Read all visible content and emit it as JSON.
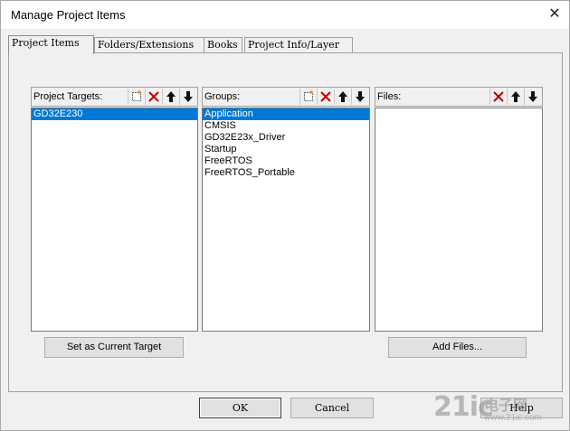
{
  "window": {
    "title": "Manage Project Items",
    "close_glyph": "✕"
  },
  "tabs": [
    {
      "label": "Project Items",
      "active": true
    },
    {
      "label": "Folders/Extensions",
      "active": false
    },
    {
      "label": "Books",
      "active": false
    },
    {
      "label": "Project Info/Layer",
      "active": false
    }
  ],
  "targets": {
    "label": "Project Targets:",
    "items": [
      "GD32E230"
    ],
    "selected": 0,
    "set_current_button": "Set as Current Target"
  },
  "groups": {
    "label": "Groups:",
    "items": [
      "Application",
      "CMSIS",
      "GD32E23x_Driver",
      "Startup",
      "FreeRTOS",
      "FreeRTOS_Portable"
    ],
    "selected": 0
  },
  "files": {
    "label": "Files:",
    "items": [],
    "add_files_button": "Add Files..."
  },
  "footer": {
    "ok": "OK",
    "cancel": "Cancel",
    "help": "Help"
  },
  "watermark": {
    "main": "21ic",
    "cn": "电子网",
    "url": "www.21ic.com"
  },
  "icons": {
    "new": "new-item-icon",
    "delete": "delete-icon",
    "up": "move-up-icon",
    "down": "move-down-icon"
  },
  "colors": {
    "selection": "#0078d7",
    "delete_red": "#c00000"
  }
}
